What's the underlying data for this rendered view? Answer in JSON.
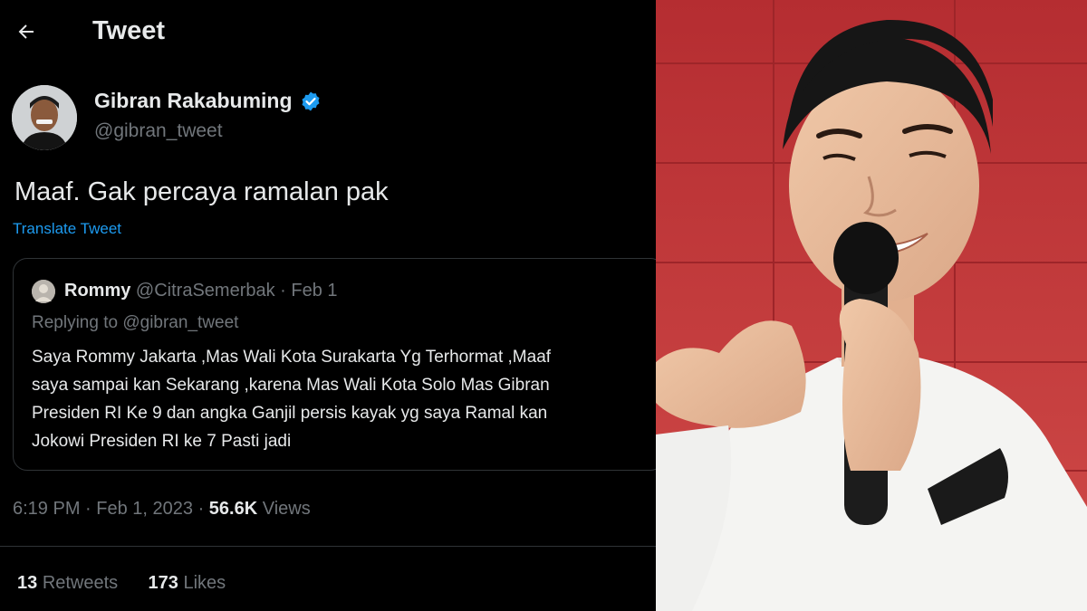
{
  "header": {
    "title": "Tweet"
  },
  "tweet": {
    "author_name": "Gibran Rakabuming",
    "author_handle": "@gibran_tweet",
    "text": "Maaf. Gak percaya ramalan pak",
    "translate_label": "Translate Tweet",
    "time": "6:19 PM",
    "date": "Feb 1, 2023",
    "views_count": "56.6K",
    "views_label": "Views",
    "retweets_count": "13",
    "retweets_label": "Retweets",
    "likes_count": "173",
    "likes_label": "Likes"
  },
  "quote": {
    "author_name": "Rommy",
    "author_handle": "@CitraSemerbak",
    "date": "Feb 1",
    "replying_to": "Replying to @gibran_tweet",
    "lines": [
      "Saya Rommy Jakarta ,Mas Wali Kota Surakarta Yg Terhormat ,Maaf",
      "saya sampai kan Sekarang ,karena Mas Wali Kota Solo Mas Gibran",
      "Presiden RI Ke 9 dan angka Ganjil persis kayak yg saya Ramal kan",
      "Jokowi Presiden RI ke 7 Pasti jadi"
    ]
  },
  "colors": {
    "background": "#000000",
    "text": "#e7e9ea",
    "muted": "#71767b",
    "link": "#1d9bf0",
    "verified": "#1d9bf0",
    "border": "#2f3336"
  },
  "icons": {
    "back": "back-arrow-icon",
    "verified": "verified-badge-icon"
  }
}
